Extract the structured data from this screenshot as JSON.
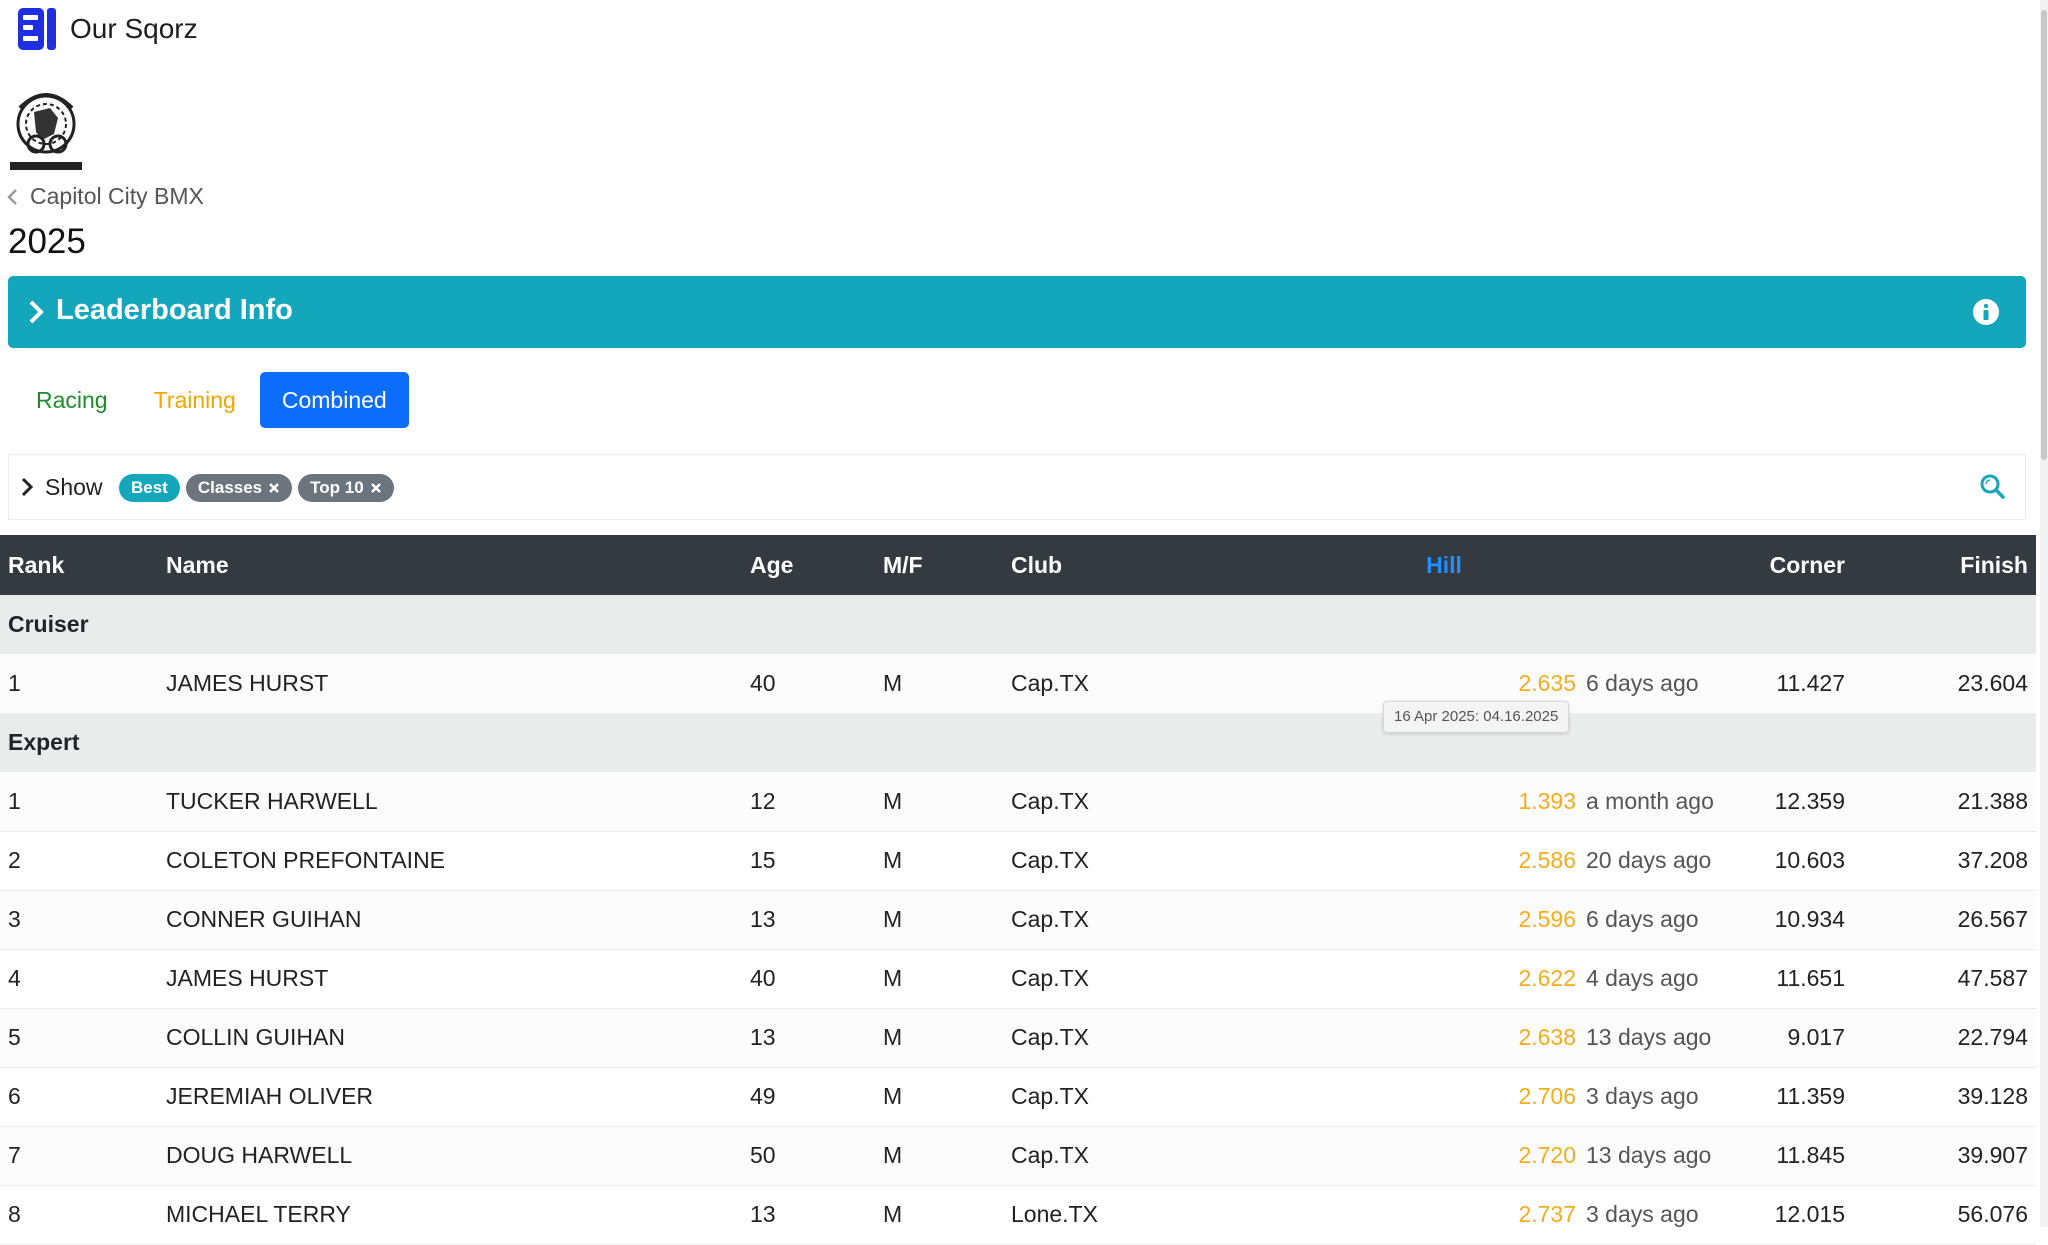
{
  "app": {
    "title": "Our Sqorz",
    "logo_icon": "sqorz-logo-icon",
    "brand_color": "#1f2fe0"
  },
  "club": {
    "name": "Capitol City BMX",
    "logo_text_top": "CAPITOL CITY BMX",
    "logo_text_bottom": "AUSTIN, TEXAS"
  },
  "season": "2025",
  "leaderboard_info": {
    "label": "Leaderboard Info",
    "color": "#14a6bb"
  },
  "tabs": [
    {
      "label": "Racing",
      "active": false
    },
    {
      "label": "Training",
      "active": false
    },
    {
      "label": "Combined",
      "active": true
    }
  ],
  "filter": {
    "show_label": "Show",
    "chips": [
      {
        "label": "Best",
        "removable": false
      },
      {
        "label": "Classes",
        "removable": true
      },
      {
        "label": "Top 10",
        "removable": true
      }
    ]
  },
  "table": {
    "columns": {
      "rank": "Rank",
      "name": "Name",
      "age": "Age",
      "mf": "M/F",
      "club": "Club",
      "hill": "Hill",
      "corner": "Corner",
      "finish": "Finish"
    },
    "groups": [
      {
        "name": "Cruiser",
        "rows": [
          {
            "rank": "1",
            "name": "JAMES HURST",
            "age": "40",
            "mf": "M",
            "club": "Cap.TX",
            "hill": "2.635",
            "hill_ago": "6 days ago",
            "corner": "11.427",
            "finish": "23.604"
          }
        ]
      },
      {
        "name": "Expert",
        "rows": [
          {
            "rank": "1",
            "name": "TUCKER HARWELL",
            "age": "12",
            "mf": "M",
            "club": "Cap.TX",
            "hill": "1.393",
            "hill_ago": "a month ago",
            "corner": "12.359",
            "finish": "21.388"
          },
          {
            "rank": "2",
            "name": "COLETON PREFONTAINE",
            "age": "15",
            "mf": "M",
            "club": "Cap.TX",
            "hill": "2.586",
            "hill_ago": "20 days ago",
            "corner": "10.603",
            "finish": "37.208"
          },
          {
            "rank": "3",
            "name": "CONNER GUIHAN",
            "age": "13",
            "mf": "M",
            "club": "Cap.TX",
            "hill": "2.596",
            "hill_ago": "6 days ago",
            "corner": "10.934",
            "finish": "26.567"
          },
          {
            "rank": "4",
            "name": "JAMES HURST",
            "age": "40",
            "mf": "M",
            "club": "Cap.TX",
            "hill": "2.622",
            "hill_ago": "4 days ago",
            "corner": "11.651",
            "finish": "47.587"
          },
          {
            "rank": "5",
            "name": "COLLIN GUIHAN",
            "age": "13",
            "mf": "M",
            "club": "Cap.TX",
            "hill": "2.638",
            "hill_ago": "13 days ago",
            "corner": "9.017",
            "finish": "22.794"
          },
          {
            "rank": "6",
            "name": "JEREMIAH OLIVER",
            "age": "49",
            "mf": "M",
            "club": "Cap.TX",
            "hill": "2.706",
            "hill_ago": "3 days ago",
            "corner": "11.359",
            "finish": "39.128"
          },
          {
            "rank": "7",
            "name": "DOUG HARWELL",
            "age": "50",
            "mf": "M",
            "club": "Cap.TX",
            "hill": "2.720",
            "hill_ago": "13 days ago",
            "corner": "11.845",
            "finish": "39.907"
          },
          {
            "rank": "8",
            "name": "MICHAEL TERRY",
            "age": "13",
            "mf": "M",
            "club": "Lone.TX",
            "hill": "2.737",
            "hill_ago": "3 days ago",
            "corner": "12.015",
            "finish": "56.076"
          }
        ]
      }
    ],
    "time_color": "#f0ad1d"
  },
  "tooltip": {
    "text": "16 Apr 2025: 04.16.2025"
  }
}
